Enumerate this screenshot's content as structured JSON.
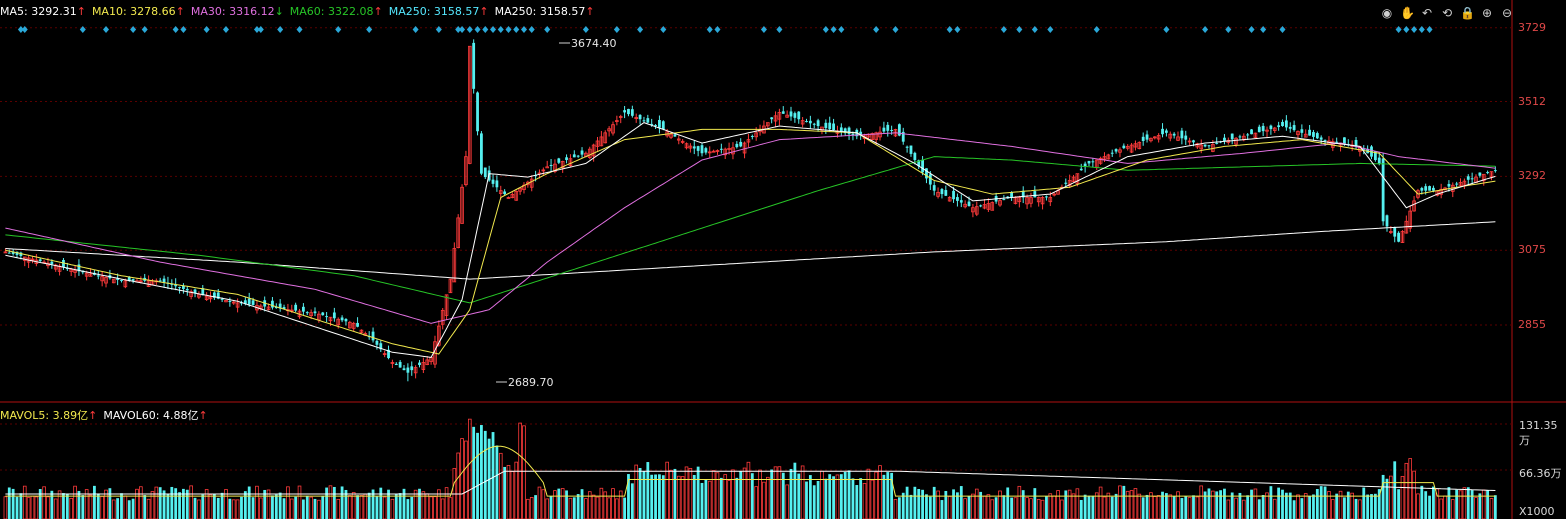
{
  "header": {
    "ma_items": [
      {
        "label": "MA5:",
        "value": "3292.31",
        "arrow": "↑",
        "color": "#ffffff"
      },
      {
        "label": "MA10:",
        "value": "3278.66",
        "arrow": "↑",
        "color": "#f2e94e"
      },
      {
        "label": "MA30:",
        "value": "3316.12",
        "arrow": "↓",
        "color": "#e070e0"
      },
      {
        "label": "MA60:",
        "value": "3322.08",
        "arrow": "↑",
        "color": "#27c527"
      },
      {
        "label": "MA250:",
        "value": "3158.57",
        "arrow": "↑",
        "color": "#55e8ff"
      },
      {
        "label": "MA250:",
        "value": "3158.57",
        "arrow": "↑",
        "color": "#ffffff"
      }
    ]
  },
  "volume_header": {
    "items": [
      {
        "label": "MAVOL5:",
        "value": "3.89亿",
        "arrow": "↑",
        "color": "#f2e94e"
      },
      {
        "label": "MAVOL60:",
        "value": "4.88亿",
        "arrow": "↑",
        "color": "#ffffff"
      }
    ]
  },
  "toolbar": {
    "icons": [
      "eye-icon",
      "hand-icon",
      "undo-icon",
      "rotate-icon",
      "lock-icon",
      "zoom-in-icon",
      "zoom-out-icon"
    ],
    "glyphs": [
      "◉",
      "✋",
      "↶",
      "⟲",
      "🔒",
      "⊕",
      "⊖"
    ]
  },
  "price_axis": {
    "ticks": [
      "3729",
      "3512",
      "3292",
      "3075",
      "2855"
    ],
    "values": [
      3729,
      3512,
      3292,
      3075,
      2855
    ]
  },
  "volume_axis": {
    "ticks": [
      "131.35万",
      "66.36万",
      "X1000"
    ]
  },
  "annotations": {
    "high": "3674.40",
    "low": "2689.70"
  },
  "colors": {
    "up": "#ff3b3b",
    "down": "#55f0f0",
    "grid": "#5a0000",
    "ma5": "#ffffff",
    "ma10": "#f2e94e",
    "ma30": "#e070e0",
    "ma60": "#27c527",
    "ma250": "#ffffff",
    "signal": "#2aa8d8"
  },
  "chart_data": {
    "type": "candlestick",
    "ylim": [
      2689.7,
      3729
    ],
    "anchors": [
      [
        0,
        3070
      ],
      [
        10,
        3040
      ],
      [
        20,
        3010
      ],
      [
        30,
        2985
      ],
      [
        40,
        2985
      ],
      [
        50,
        2945
      ],
      [
        60,
        2920
      ],
      [
        70,
        2905
      ],
      [
        80,
        2890
      ],
      [
        90,
        2860
      ],
      [
        95,
        2810
      ],
      [
        100,
        2745
      ],
      [
        104,
        2715
      ],
      [
        110,
        2760
      ],
      [
        115,
        2990
      ],
      [
        119,
        3350
      ],
      [
        120,
        3674
      ],
      [
        123,
        3300
      ],
      [
        130,
        3230
      ],
      [
        140,
        3320
      ],
      [
        150,
        3360
      ],
      [
        160,
        3480
      ],
      [
        170,
        3430
      ],
      [
        180,
        3360
      ],
      [
        190,
        3380
      ],
      [
        200,
        3480
      ],
      [
        210,
        3440
      ],
      [
        220,
        3410
      ],
      [
        230,
        3430
      ],
      [
        240,
        3250
      ],
      [
        250,
        3200
      ],
      [
        260,
        3230
      ],
      [
        270,
        3230
      ],
      [
        280,
        3330
      ],
      [
        290,
        3380
      ],
      [
        300,
        3420
      ],
      [
        310,
        3380
      ],
      [
        320,
        3410
      ],
      [
        330,
        3440
      ],
      [
        340,
        3400
      ],
      [
        350,
        3380
      ],
      [
        355,
        3330
      ],
      [
        356,
        3160
      ],
      [
        360,
        3100
      ],
      [
        365,
        3250
      ],
      [
        370,
        3250
      ],
      [
        380,
        3290
      ],
      [
        385,
        3310
      ]
    ],
    "ma5_anchors": [
      [
        0,
        3060
      ],
      [
        30,
        2990
      ],
      [
        60,
        2925
      ],
      [
        100,
        2775
      ],
      [
        110,
        2760
      ],
      [
        118,
        2930
      ],
      [
        125,
        3300
      ],
      [
        135,
        3290
      ],
      [
        150,
        3330
      ],
      [
        165,
        3450
      ],
      [
        180,
        3390
      ],
      [
        200,
        3440
      ],
      [
        220,
        3420
      ],
      [
        235,
        3330
      ],
      [
        250,
        3220
      ],
      [
        270,
        3240
      ],
      [
        290,
        3350
      ],
      [
        310,
        3390
      ],
      [
        330,
        3410
      ],
      [
        350,
        3380
      ],
      [
        358,
        3260
      ],
      [
        362,
        3200
      ],
      [
        370,
        3240
      ],
      [
        385,
        3292
      ]
    ],
    "ma10_anchors": [
      [
        0,
        3075
      ],
      [
        30,
        3000
      ],
      [
        60,
        2945
      ],
      [
        100,
        2800
      ],
      [
        112,
        2770
      ],
      [
        120,
        2900
      ],
      [
        128,
        3230
      ],
      [
        140,
        3300
      ],
      [
        160,
        3400
      ],
      [
        180,
        3430
      ],
      [
        200,
        3430
      ],
      [
        220,
        3420
      ],
      [
        240,
        3280
      ],
      [
        255,
        3240
      ],
      [
        275,
        3260
      ],
      [
        295,
        3340
      ],
      [
        315,
        3380
      ],
      [
        335,
        3400
      ],
      [
        355,
        3360
      ],
      [
        365,
        3240
      ],
      [
        375,
        3260
      ],
      [
        385,
        3278
      ]
    ],
    "ma30_anchors": [
      [
        0,
        3140
      ],
      [
        40,
        3040
      ],
      [
        80,
        2960
      ],
      [
        110,
        2860
      ],
      [
        125,
        2900
      ],
      [
        140,
        3040
      ],
      [
        160,
        3200
      ],
      [
        180,
        3340
      ],
      [
        200,
        3400
      ],
      [
        230,
        3420
      ],
      [
        260,
        3380
      ],
      [
        290,
        3330
      ],
      [
        320,
        3360
      ],
      [
        345,
        3390
      ],
      [
        360,
        3350
      ],
      [
        385,
        3316
      ]
    ],
    "ma60_anchors": [
      [
        0,
        3120
      ],
      [
        50,
        3060
      ],
      [
        90,
        3000
      ],
      [
        120,
        2920
      ],
      [
        150,
        3030
      ],
      [
        180,
        3140
      ],
      [
        210,
        3250
      ],
      [
        240,
        3350
      ],
      [
        260,
        3340
      ],
      [
        290,
        3310
      ],
      [
        320,
        3320
      ],
      [
        350,
        3330
      ],
      [
        385,
        3322
      ]
    ],
    "ma250_anchors": [
      [
        0,
        3080
      ],
      [
        60,
        3040
      ],
      [
        120,
        2990
      ],
      [
        180,
        3030
      ],
      [
        240,
        3070
      ],
      [
        300,
        3100
      ],
      [
        340,
        3130
      ],
      [
        385,
        3158.57
      ]
    ],
    "volume": {
      "ylim": [
        0,
        1313500
      ],
      "mavol_label": [
        "MAVOL5",
        "MAVOL60"
      ]
    }
  }
}
